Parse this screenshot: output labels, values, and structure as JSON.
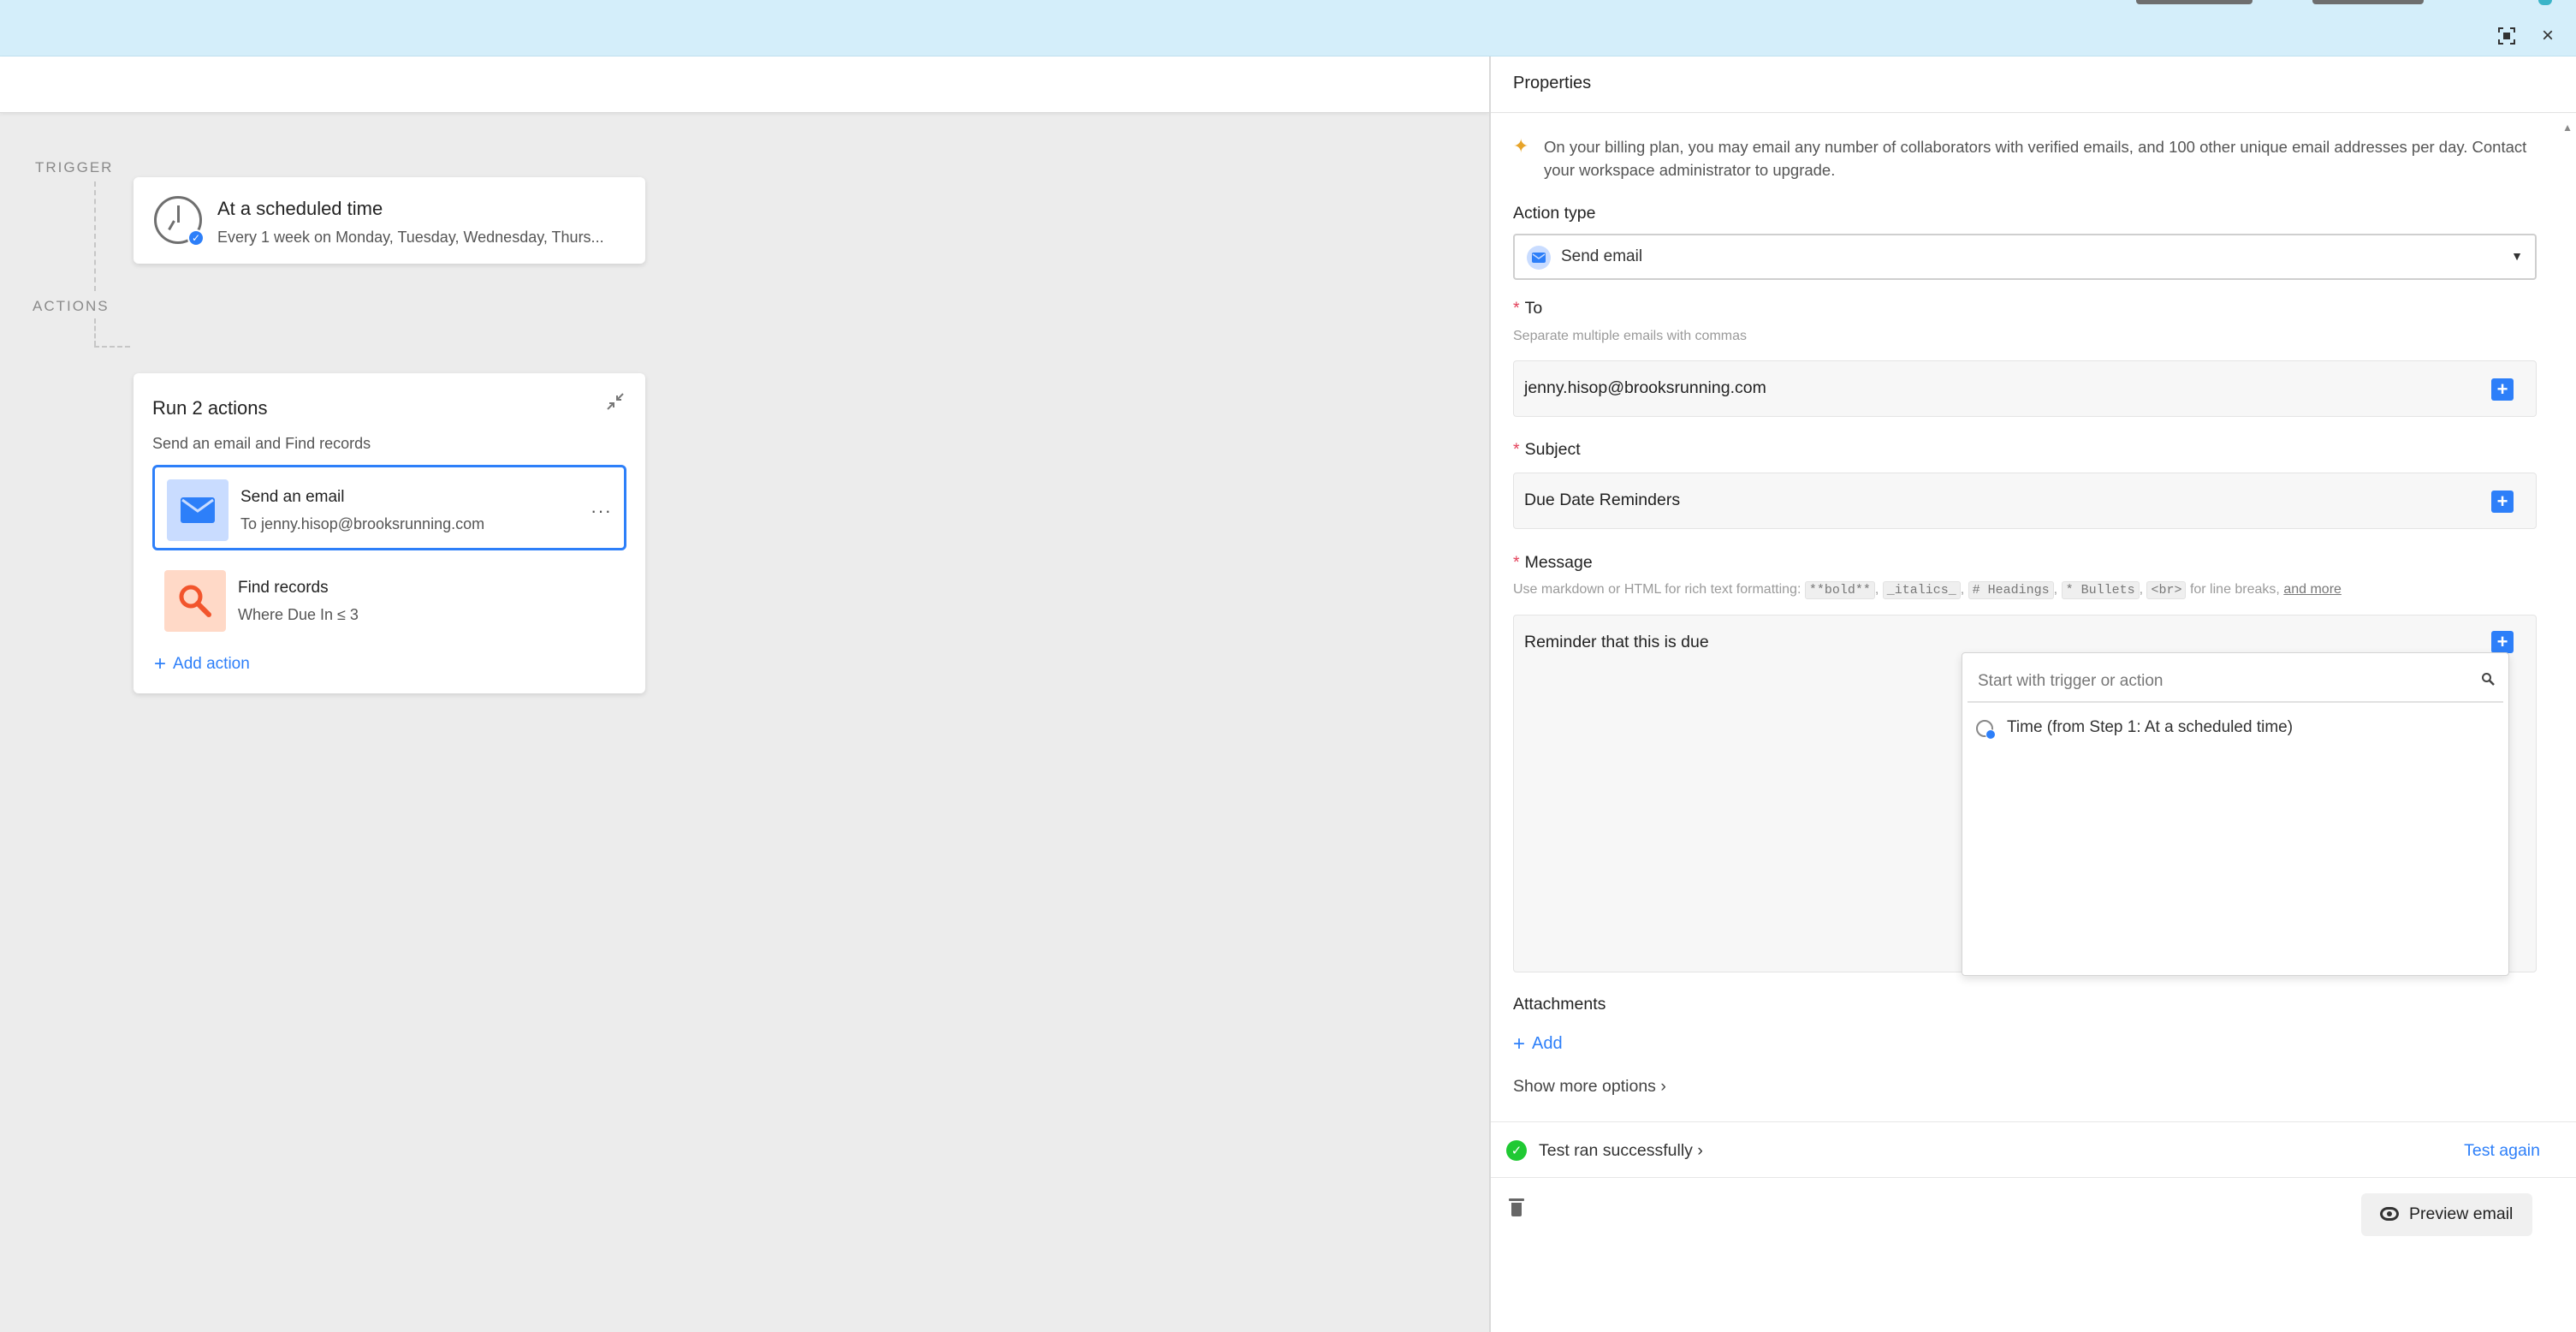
{
  "header": {
    "focus_icon": "focus-icon",
    "close_icon": "close-icon"
  },
  "canvas": {
    "trigger_label": "TRIGGER",
    "actions_label": "ACTIONS",
    "trigger": {
      "title": "At a scheduled time",
      "subtitle": "Every 1 week on Monday, Tuesday, Wednesday, Thurs..."
    },
    "actions_group": {
      "title": "Run 2 actions",
      "subtitle": "Send an email and Find records",
      "items": [
        {
          "name": "Send an email",
          "description": "To jenny.hisop@brooksrunning.com",
          "icon": "envelope-icon"
        },
        {
          "name": "Find records",
          "description": "Where Due In ≤ 3",
          "icon": "magnifier-icon"
        }
      ],
      "more_label": "···",
      "add_action_label": "Add action"
    }
  },
  "panel": {
    "title": "Properties",
    "notice": "On your billing plan, you may email any number of collaborators with verified emails, and 100 other unique email addresses per day. Contact your workspace administrator to upgrade.",
    "action_type": {
      "label": "Action type",
      "value": "Send email"
    },
    "to": {
      "label": "To",
      "hint": "Separate multiple emails with commas",
      "value": "jenny.hisop@brooksrunning.com"
    },
    "subject": {
      "label": "Subject",
      "value": "Due Date Reminders"
    },
    "message": {
      "label": "Message",
      "hint_prefix": "Use markdown or HTML for rich text formatting:",
      "hint_codes": [
        "**bold**",
        "_italics_",
        "# Headings",
        "* Bullets",
        "<br>"
      ],
      "hint_suffix": "for line breaks,",
      "hint_link": "and more",
      "value": "Reminder that this is due"
    },
    "token_picker": {
      "placeholder": "Start with trigger or action",
      "options": [
        "Time (from Step 1: At a scheduled time)"
      ]
    },
    "attachments": {
      "label": "Attachments",
      "add_label": "Add"
    },
    "show_more_label": "Show more options ›",
    "test": {
      "status": "Test ran successfully ›",
      "again_label": "Test again"
    },
    "preview_label": "Preview email"
  },
  "colors": {
    "accent": "#2d7ff9",
    "success": "#20c933",
    "required": "#e3425b",
    "banner": "#d4eefa"
  }
}
